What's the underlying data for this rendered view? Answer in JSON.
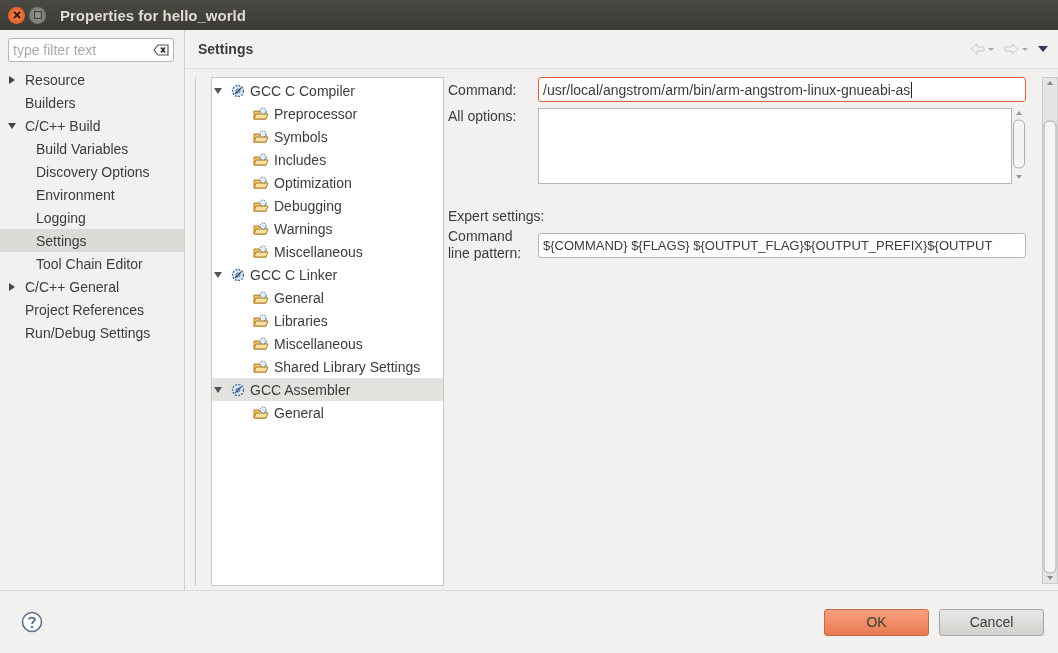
{
  "window": {
    "title": "Properties for hello_world"
  },
  "filter": {
    "placeholder": "type filter text"
  },
  "nav": [
    {
      "label": "Resource",
      "expanded": false,
      "selected": false
    },
    {
      "label": "Builders",
      "selected": false
    },
    {
      "label": "C/C++ Build",
      "expanded": true,
      "selected": false,
      "children": [
        {
          "label": "Build Variables",
          "selected": false
        },
        {
          "label": "Discovery Options",
          "selected": false
        },
        {
          "label": "Environment",
          "selected": false
        },
        {
          "label": "Logging",
          "selected": false
        },
        {
          "label": "Settings",
          "selected": true
        },
        {
          "label": "Tool Chain Editor",
          "selected": false
        }
      ]
    },
    {
      "label": "C/C++ General",
      "expanded": false,
      "selected": false
    },
    {
      "label": "Project References",
      "selected": false
    },
    {
      "label": "Run/Debug Settings",
      "selected": false
    }
  ],
  "page_title": "Settings",
  "tool_tree": [
    {
      "label": "GCC C Compiler",
      "kind": "tool",
      "expanded": true,
      "selected": false,
      "children": [
        {
          "label": "Preprocessor",
          "kind": "category",
          "selected": false
        },
        {
          "label": "Symbols",
          "kind": "category",
          "selected": false
        },
        {
          "label": "Includes",
          "kind": "category",
          "selected": false
        },
        {
          "label": "Optimization",
          "kind": "category",
          "selected": false
        },
        {
          "label": "Debugging",
          "kind": "category",
          "selected": false
        },
        {
          "label": "Warnings",
          "kind": "category",
          "selected": false
        },
        {
          "label": "Miscellaneous",
          "kind": "category",
          "selected": false
        }
      ]
    },
    {
      "label": "GCC C Linker",
      "kind": "tool",
      "expanded": true,
      "selected": false,
      "children": [
        {
          "label": "General",
          "kind": "category",
          "selected": false
        },
        {
          "label": "Libraries",
          "kind": "category",
          "selected": false
        },
        {
          "label": "Miscellaneous",
          "kind": "category",
          "selected": false
        },
        {
          "label": "Shared Library Settings",
          "kind": "category",
          "selected": false
        }
      ]
    },
    {
      "label": "GCC Assembler",
      "kind": "tool",
      "expanded": true,
      "selected": true,
      "children": [
        {
          "label": "General",
          "kind": "category",
          "selected": false
        }
      ]
    }
  ],
  "form": {
    "command_label": "Command:",
    "command_value": "/usr/local/angstrom/arm/bin/arm-angstrom-linux-gnueabi-as",
    "all_options_label": "All options:",
    "expert_heading": "Expert settings:",
    "pattern_label": "Command line pattern:",
    "pattern_value": "${COMMAND} ${FLAGS} ${OUTPUT_FLAG}${OUTPUT_PREFIX}${OUTPUT"
  },
  "buttons": [
    {
      "label": "OK",
      "kind": "primary"
    },
    {
      "label": "Cancel",
      "kind": "secondary"
    }
  ]
}
